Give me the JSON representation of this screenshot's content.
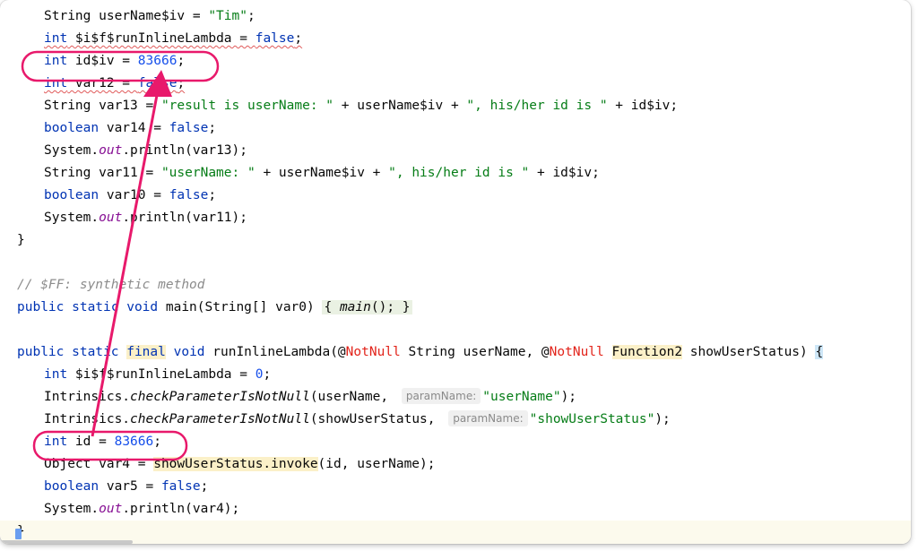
{
  "colors": {
    "keyword": "#0033b3",
    "string": "#067d17",
    "number": "#1750eb",
    "comment": "#8c8c8c",
    "annotation": "#e2231a",
    "highlight": "#fbf0c8",
    "callout": "#e8196b"
  },
  "code": {
    "l1": {
      "a": "String userName$iv = ",
      "b": "\"Tim\"",
      "c": ";"
    },
    "l2": {
      "a": "int",
      "b": " $i$f$runInlineLambda = ",
      "c": "false",
      "d": ";"
    },
    "l3": {
      "a": "int",
      "b": " id$iv = ",
      "c": "83666",
      "d": ";"
    },
    "l4": {
      "a": "int",
      "b": " var12 = ",
      "c": "false",
      "d": ";"
    },
    "l5": {
      "a": "String var13 = ",
      "b": "\"result is userName: \"",
      "c": " + userName$iv + ",
      "d": "\", his/her id is \"",
      "e": " + id$iv;"
    },
    "l6": {
      "a": "boolean",
      "b": " var14 = ",
      "c": "false",
      "d": ";"
    },
    "l7": {
      "a": "System.",
      "b": "out",
      "c": ".println(var13);"
    },
    "l8": {
      "a": "String var11 = ",
      "b": "\"userName: \"",
      "c": " + userName$iv + ",
      "d": "\", his/her id is \"",
      "e": " + id$iv;"
    },
    "l9": {
      "a": "boolean",
      "b": " var10 = ",
      "c": "false",
      "d": ";"
    },
    "l10": {
      "a": "System.",
      "b": "out",
      "c": ".println(var11);"
    },
    "l11": {
      "a": "}"
    },
    "l12": {
      "a": "// $FF: synthetic method"
    },
    "l13": {
      "a": "public static void",
      "b": " main(String[] var0) ",
      "c": "{ ",
      "d": "main",
      "e": "(); }"
    },
    "l14": {
      "a": "public static ",
      "b": "final",
      "c": " void",
      "d": " runInlineLambda(@",
      "e": "NotNull",
      "f": " String userName, @",
      "g": "NotNull",
      "h": " ",
      "i": "Function2",
      "j": " showUserStatus) ",
      "k": "{"
    },
    "l15": {
      "a": "int",
      "b": " $i$f$runInlineLambda = ",
      "c": "0",
      "d": ";"
    },
    "l16": {
      "a": "Intrinsics.",
      "b": "checkParameterIsNotNull",
      "c": "(userName, ",
      "h": "paramName:",
      "d": "\"userName\"",
      "e": ");"
    },
    "l17": {
      "a": "Intrinsics.",
      "b": "checkParameterIsNotNull",
      "c": "(showUserStatus, ",
      "h": "paramName:",
      "d": "\"showUserStatus\"",
      "e": ");"
    },
    "l18": {
      "a": "int",
      "b": " id = ",
      "c": "83666",
      "d": ";"
    },
    "l19": {
      "a": "Object var4 = ",
      "b": "showUserStatus.invoke",
      "c": "(id, userName);"
    },
    "l20": {
      "a": "boolean",
      "b": " var5 = ",
      "c": "false",
      "d": ";"
    },
    "l21": {
      "a": "System.",
      "b": "out",
      "c": ".println(var4);"
    },
    "l22": {
      "a": "}"
    }
  }
}
